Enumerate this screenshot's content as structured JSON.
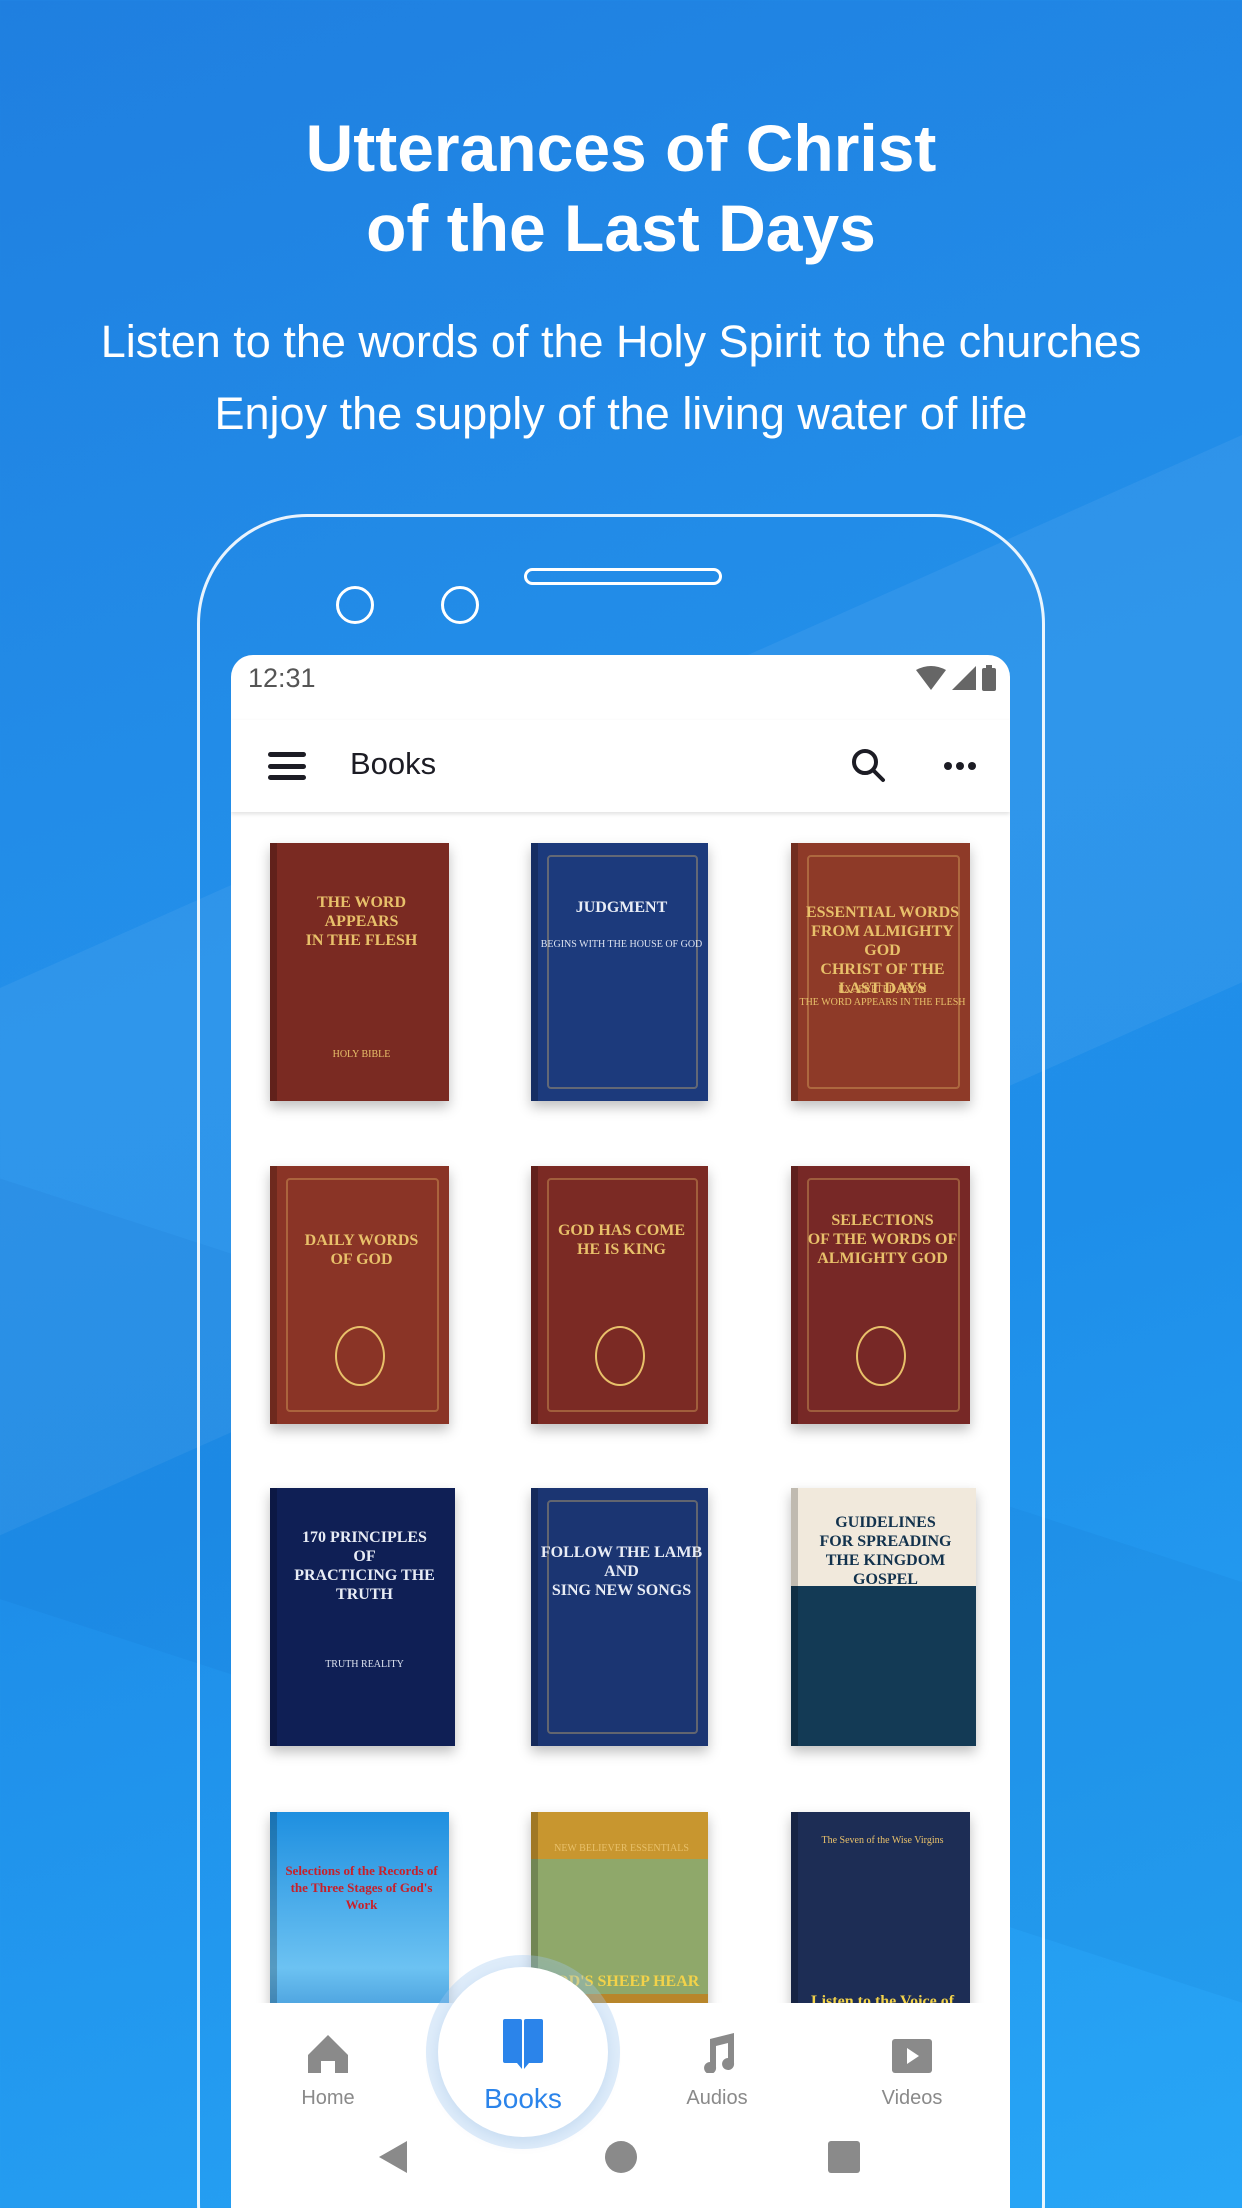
{
  "hero": {
    "title": "Utterances of Christ\nof the Last Days",
    "subtitle_line1": "Listen to the words of the Holy Spirit to the churches",
    "subtitle_line2": "Enjoy the supply of the living water of life"
  },
  "status_bar": {
    "time": "12:31",
    "icons": [
      "wifi-icon",
      "signal-icon",
      "battery-icon"
    ]
  },
  "app_bar": {
    "title": "Books",
    "icons": [
      "menu-icon",
      "search-icon",
      "more-icon"
    ]
  },
  "books": [
    {
      "title": "THE WORD\nAPPEARS\nIN THE FLESH",
      "subtitle": "HOLY BIBLE",
      "color": "#7a2a22"
    },
    {
      "title": "JUDGMENT",
      "subtitle": "BEGINS WITH THE HOUSE OF GOD",
      "color": "#1c3a7c"
    },
    {
      "title": "ESSENTIAL WORDS\nFROM ALMIGHTY GOD\nCHRIST OF THE LAST DAYS",
      "subtitle": "EXCERPTED FROM\nTHE WORD APPEARS IN THE FLESH",
      "color": "#8e3a28"
    },
    {
      "title": "DAILY WORDS\nOF GOD",
      "subtitle": "",
      "color": "#8a3426"
    },
    {
      "title": "GOD HAS COME\nHE IS KING",
      "subtitle": "",
      "color": "#7b2a24"
    },
    {
      "title": "SELECTIONS\nOF THE WORDS OF\nALMIGHTY GOD",
      "subtitle": "",
      "color": "#772826"
    },
    {
      "title": "170 PRINCIPLES\nOF\nPRACTICING THE TRUTH",
      "subtitle": "TRUTH REALITY",
      "color": "#0f1f55"
    },
    {
      "title": "FOLLOW THE LAMB\nAND\nSING NEW SONGS",
      "subtitle": "",
      "color": "#1b3572"
    },
    {
      "title": "GUIDELINES\nFOR SPREADING\nTHE KINGDOM GOSPEL",
      "subtitle": "",
      "color": "#133a55"
    },
    {
      "title": "Selections of the Records of\nthe Three Stages of God's Work",
      "subtitle": "",
      "color": "#2a9be0"
    },
    {
      "title": "GOD'S SHEEP HEAR",
      "subtitle": "NEW BELIEVER ESSENTIALS",
      "color": "#b8862a"
    },
    {
      "title": "Listen to the Voice of God",
      "subtitle": "The Seven of the Wise Virgins",
      "color": "#1d2d55"
    }
  ],
  "bottom_nav": {
    "items": [
      {
        "label": "Home",
        "icon": "home-icon"
      },
      {
        "label": "Books",
        "icon": "book-icon",
        "active": true
      },
      {
        "label": "Audios",
        "icon": "music-note-icon"
      },
      {
        "label": "Videos",
        "icon": "video-icon"
      }
    ],
    "active_color": "#2b84ea",
    "inactive_color": "#8a8a8a"
  },
  "system_nav": [
    "back-icon",
    "home-circle-icon",
    "recents-icon"
  ]
}
